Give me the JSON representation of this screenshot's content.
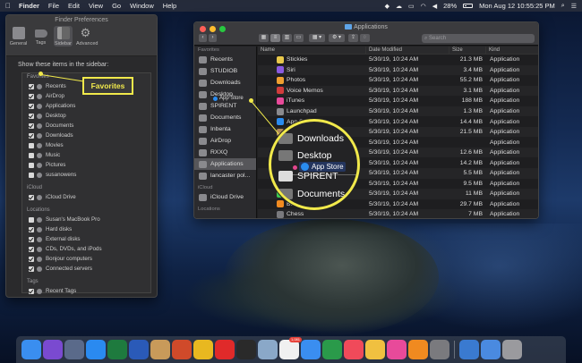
{
  "menubar": {
    "apple": "",
    "items": [
      "Finder",
      "File",
      "Edit",
      "View",
      "Go",
      "Window",
      "Help"
    ],
    "battery": "28%",
    "datetime": "Mon Aug 12  10:55:25 PM"
  },
  "prefs": {
    "title": "Finder Preferences",
    "tabs": [
      "General",
      "Tags",
      "Sidebar",
      "Advanced"
    ],
    "instruction": "Show these items in the sidebar:",
    "sections": [
      {
        "name": "Favorites",
        "items": [
          {
            "label": "Recents",
            "checked": true
          },
          {
            "label": "AirDrop",
            "checked": true
          },
          {
            "label": "Applications",
            "checked": true
          },
          {
            "label": "Desktop",
            "checked": true
          },
          {
            "label": "Documents",
            "checked": true
          },
          {
            "label": "Downloads",
            "checked": true
          },
          {
            "label": "Movies",
            "checked": false
          },
          {
            "label": "Music",
            "checked": false
          },
          {
            "label": "Pictures",
            "checked": false
          },
          {
            "label": "susanowens",
            "checked": false
          }
        ]
      },
      {
        "name": "iCloud",
        "items": [
          {
            "label": "iCloud Drive",
            "checked": true
          }
        ]
      },
      {
        "name": "Locations",
        "items": [
          {
            "label": "Susan's MacBook Pro",
            "checked": false
          },
          {
            "label": "Hard disks",
            "checked": true
          },
          {
            "label": "External disks",
            "checked": true
          },
          {
            "label": "CDs, DVDs, and iPods",
            "checked": true
          },
          {
            "label": "Bonjour computers",
            "checked": true
          },
          {
            "label": "Connected servers",
            "checked": true
          }
        ]
      },
      {
        "name": "Tags",
        "items": [
          {
            "label": "Recent Tags",
            "checked": true
          }
        ]
      }
    ]
  },
  "callout_favorites": "Favorites",
  "finder": {
    "title": "Applications",
    "search_placeholder": "Search",
    "sidebar": {
      "favorites_label": "Favorites",
      "items": [
        {
          "label": "Recents",
          "selected": false
        },
        {
          "label": "STUDIOB",
          "selected": false
        },
        {
          "label": "Downloads",
          "selected": false
        },
        {
          "label": "Desktop",
          "selected": false
        },
        {
          "label": "SPIRENT",
          "selected": false
        },
        {
          "label": "Documents",
          "selected": false
        },
        {
          "label": "Inbenta",
          "selected": false
        },
        {
          "label": "AirDrop",
          "selected": false
        },
        {
          "label": "RXXQ",
          "selected": false
        },
        {
          "label": "Applications",
          "selected": true
        },
        {
          "label": "lancaster pol...",
          "selected": false
        }
      ],
      "icloud_label": "iCloud",
      "icloud_item": "iCloud Drive",
      "locations_label": "Locations"
    },
    "drag_label": "App Store",
    "columns": [
      "Name",
      "Date Modified",
      "Size",
      "Kind"
    ],
    "rows": [
      {
        "name": "Stickies",
        "date": "5/30/19, 10:24 AM",
        "size": "21.3 MB",
        "kind": "Application",
        "color": "#e8c84a"
      },
      {
        "name": "Siri",
        "date": "5/30/19, 10:24 AM",
        "size": "3.4 MB",
        "kind": "Application",
        "color": "#8a5ae0"
      },
      {
        "name": "Photos",
        "date": "5/30/19, 10:24 AM",
        "size": "55.2 MB",
        "kind": "Application",
        "color": "#f0a030"
      },
      {
        "name": "Voice Memos",
        "date": "5/30/19, 10:24 AM",
        "size": "3.1 MB",
        "kind": "Application",
        "color": "#d23c3c"
      },
      {
        "name": "iTunes",
        "date": "5/30/19, 10:24 AM",
        "size": "188 MB",
        "kind": "Application",
        "color": "#e84a9a"
      },
      {
        "name": "Launchpad",
        "date": "5/30/19, 10:24 AM",
        "size": "1.3 MB",
        "kind": "Application",
        "color": "#8a8a8e"
      },
      {
        "name": "App Store",
        "date": "5/30/19, 10:24 AM",
        "size": "14.4 MB",
        "kind": "Application",
        "color": "#2a8cf0"
      },
      {
        "name": "Contacts",
        "date": "5/30/19, 10:24 AM",
        "size": "21.5 MB",
        "kind": "Application",
        "color": "#b08a5a"
      },
      {
        "name": "Downloads",
        "date": "5/30/19, 10:24 AM",
        "size": "",
        "kind": "Application",
        "color": "#6a6a6e"
      },
      {
        "name": "Desktop",
        "date": "5/30/19, 10:24 AM",
        "size": "12.6 MB",
        "kind": "Application",
        "color": "#6a6a6e"
      },
      {
        "name": "App Store",
        "date": "5/30/19, 10:24 AM",
        "size": "14.2 MB",
        "kind": "Application",
        "color": "#2a8cf0"
      },
      {
        "name": "SPIRENT",
        "date": "5/30/19, 10:24 AM",
        "size": "5.5 MB",
        "kind": "Application",
        "color": "#6a6a6e"
      },
      {
        "name": "Mail",
        "date": "5/30/19, 10:24 AM",
        "size": "9.5 MB",
        "kind": "Application",
        "color": "#3c8ce8"
      },
      {
        "name": "FaceTime",
        "date": "5/30/19, 10:24 AM",
        "size": "11 MB",
        "kind": "Application",
        "color": "#3cc850"
      },
      {
        "name": "Books",
        "date": "5/30/19, 10:24 AM",
        "size": "29.7 MB",
        "kind": "Application",
        "color": "#f08a20"
      },
      {
        "name": "Chess",
        "date": "5/30/19, 10:24 AM",
        "size": "7 MB",
        "kind": "Application",
        "color": "#7a7a7e"
      }
    ]
  },
  "magnifier": {
    "downloads": "Downloads",
    "desktop": "Desktop",
    "app_store": "App Store",
    "spirent": "SPIRENT",
    "documents": "Documents"
  },
  "dock": {
    "icons": [
      {
        "name": "finder-icon",
        "color": "#3a8ef0"
      },
      {
        "name": "siri-icon",
        "color": "#7a4ad0"
      },
      {
        "name": "launchpad-icon",
        "color": "#5a6a8a"
      },
      {
        "name": "safari-icon",
        "color": "#2a8af0"
      },
      {
        "name": "excel-icon",
        "color": "#1e7a3e"
      },
      {
        "name": "word-icon",
        "color": "#2a5ab8"
      },
      {
        "name": "stamp-icon",
        "color": "#c89a5a"
      },
      {
        "name": "powerpoint-icon",
        "color": "#d04a2a"
      },
      {
        "name": "chrome-icon",
        "color": "#e8b820"
      },
      {
        "name": "opera-icon",
        "color": "#e02a2a"
      },
      {
        "name": "kindle-icon",
        "color": "#2a2a2a"
      },
      {
        "name": "preview-icon",
        "color": "#8aa8c8"
      },
      {
        "name": "calendar-icon",
        "color": "#f0f0f0"
      },
      {
        "name": "mail-icon",
        "color": "#3a8ef0"
      },
      {
        "name": "numbers-icon",
        "color": "#2a9a4a"
      },
      {
        "name": "news-icon",
        "color": "#f04a5a"
      },
      {
        "name": "photos-icon",
        "color": "#f0c040"
      },
      {
        "name": "itunes-icon",
        "color": "#e84a9a"
      },
      {
        "name": "books-icon",
        "color": "#f08a20"
      },
      {
        "name": "system-preferences-icon",
        "color": "#7a7a7e"
      },
      {
        "name": "bluetooth-file-icon",
        "color": "#3a7ad0"
      },
      {
        "name": "downloads-stack-icon",
        "color": "#4a8ae0"
      },
      {
        "name": "trash-icon",
        "color": "#9a9a9e"
      }
    ],
    "calendar_badge": "1,081"
  }
}
